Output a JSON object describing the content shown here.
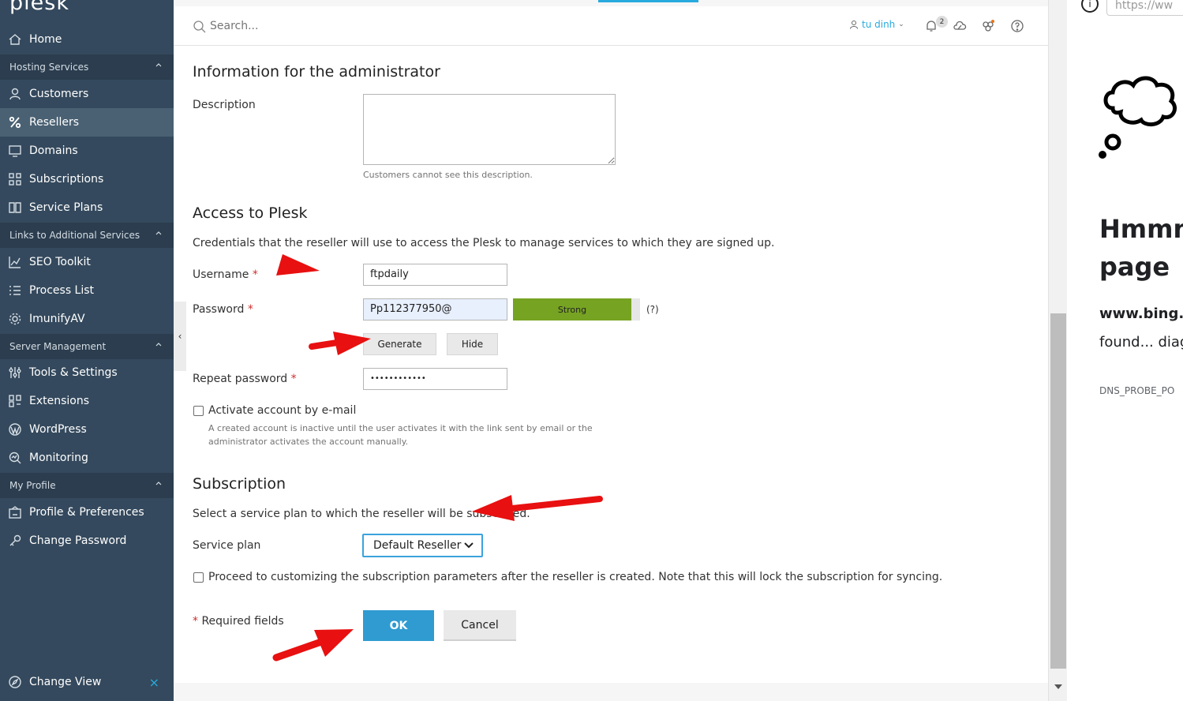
{
  "sidebar": {
    "logo": "plesk",
    "items": [
      {
        "label": "Home",
        "icon": "home-icon"
      },
      {
        "section": "Hosting Services"
      },
      {
        "label": "Customers",
        "icon": "user-icon"
      },
      {
        "label": "Resellers",
        "icon": "percent-icon"
      },
      {
        "label": "Domains",
        "icon": "monitor-icon"
      },
      {
        "label": "Subscriptions",
        "icon": "grid-icon"
      },
      {
        "label": "Service Plans",
        "icon": "book-icon"
      },
      {
        "section": "Links to Additional Services"
      },
      {
        "label": "SEO Toolkit",
        "icon": "chart-icon"
      },
      {
        "label": "Process List",
        "icon": "list-icon"
      },
      {
        "label": "ImunifyAV",
        "icon": "gear-icon"
      },
      {
        "section": "Server Management"
      },
      {
        "label": "Tools & Settings",
        "icon": "sliders-icon"
      },
      {
        "label": "Extensions",
        "icon": "extensions-icon"
      },
      {
        "label": "WordPress",
        "icon": "wordpress-icon"
      },
      {
        "label": "Monitoring",
        "icon": "monitoring-icon"
      },
      {
        "section": "My Profile"
      },
      {
        "label": "Profile & Preferences",
        "icon": "profile-icon"
      },
      {
        "label": "Change Password",
        "icon": "key-icon"
      }
    ],
    "change_view": "Change View"
  },
  "topbar": {
    "search_placeholder": "Search...",
    "user": "tu dinh",
    "notifications_count": "2"
  },
  "form": {
    "admin_info_title": "Information for the administrator",
    "description_label": "Description",
    "description_value": "",
    "description_hint": "Customers cannot see this description.",
    "access_title": "Access to Plesk",
    "access_desc": "Credentials that the reseller will use to access the Plesk to manage services to which they are signed up.",
    "username_label": "Username",
    "username_value": "ftpdaily",
    "password_label": "Password",
    "password_value": "Pp112377950@",
    "strength": "Strong",
    "help": "(?)",
    "generate": "Generate",
    "hide": "Hide",
    "repeat_label": "Repeat password",
    "repeat_value": "••••••••••••",
    "activate_label": "Activate account by e-mail",
    "activate_hint_1": "A created account is inactive until the user activates it with the link sent by email or the",
    "activate_hint_2": "administrator activates the account manually.",
    "subscription_title": "Subscription",
    "subscription_desc": "Select a service plan to which the reseller will be subscribed.",
    "service_plan_label": "Service plan",
    "service_plan_value": "Default Reseller",
    "proceed_label": "Proceed to customizing the subscription parameters after the reseller is created. Note that this will lock the subscription for syncing.",
    "required_fields": "Required fields",
    "required_star": "*",
    "ok": "OK",
    "cancel": "Cancel"
  },
  "browser_error": {
    "url": "https://ww",
    "title_1": "Hmmm",
    "title_2": "page",
    "domain": "www.bing.",
    "desc": "found... diag",
    "code": "DNS_PROBE_PO"
  },
  "colors": {
    "sidebar_bg": "#34495d",
    "section_bg": "#2b3d4e",
    "active_bg": "#4a6173",
    "accent": "#28aade",
    "strength_bar": "#77a323",
    "arrow": "#e81010"
  }
}
